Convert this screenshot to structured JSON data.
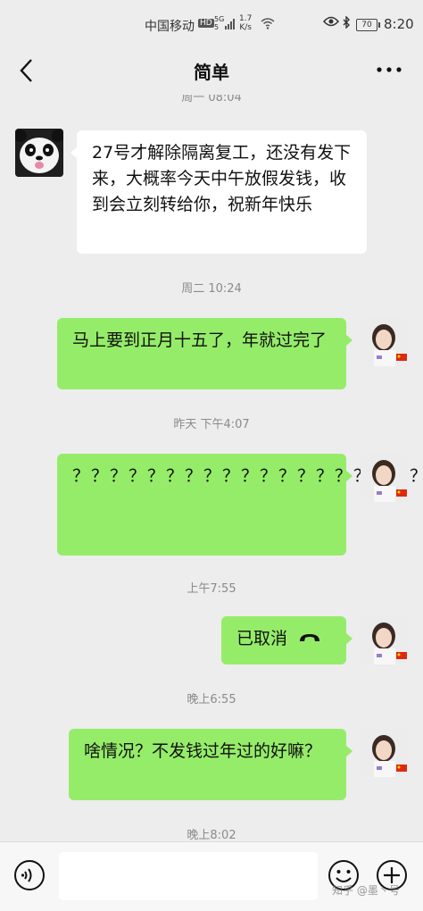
{
  "status_bar": {
    "carrier": "中国移动",
    "hd": "HD",
    "signal_type": "5G",
    "signal_sub": "5",
    "speed_value": "1.7",
    "speed_unit": "K/s",
    "battery": "70",
    "time": "8:20"
  },
  "nav": {
    "title": "简单"
  },
  "chat": {
    "top_partial_timestamp": "周一 08:04",
    "messages": [
      {
        "side": "in",
        "text": "27号才解除隔离复工，还没有发下来，大概率今天中午放假发钱，收到会立刻转给你，祝新年快乐"
      },
      {
        "timestamp": "周二 10:24"
      },
      {
        "side": "out",
        "text": "马上要到正月十五了，年就过完了"
      },
      {
        "timestamp": "昨天 下午4:07"
      },
      {
        "side": "out",
        "text": "？？？？？？？？？？？？？？？？？？？？？？？？？？？？？？？"
      },
      {
        "timestamp": "上午7:55"
      },
      {
        "side": "out",
        "text": "已取消",
        "icon": "phone-hangup-icon"
      },
      {
        "timestamp": "晚上6:55"
      },
      {
        "side": "out",
        "text": "啥情况？不发钱过年过的好嘛？"
      },
      {
        "timestamp": "晚上8:02"
      }
    ]
  },
  "input": {
    "placeholder": ""
  },
  "watermark": "知乎 @墨丶号"
}
